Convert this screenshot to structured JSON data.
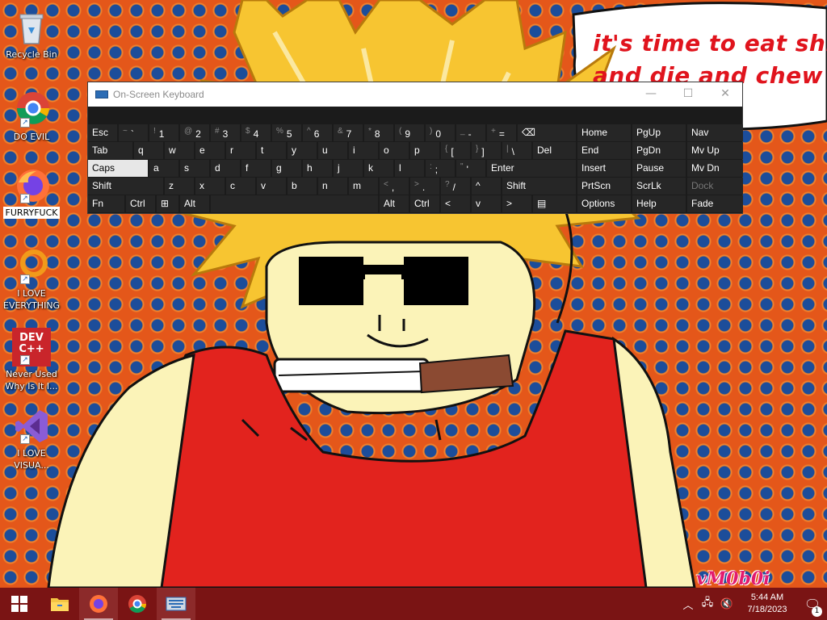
{
  "wallpaper": {
    "speech_line1": "it's time to eat shit",
    "speech_line2": "and die and chew",
    "watermark": "vM0b0i"
  },
  "desktop_icons": [
    {
      "label": "Recycle Bin",
      "icon": "recycle-bin-icon"
    },
    {
      "label": "DO EVIL",
      "icon": "chrome-icon"
    },
    {
      "label": "FURRYFUCK",
      "icon": "firefox-icon"
    },
    {
      "label": "I LOVE EVERYTHING",
      "icon": "ring-icon"
    },
    {
      "label": "Never Used Why Is It I...",
      "icon": "dev-cpp-icon",
      "badge": "DEV C++"
    },
    {
      "label": "I LOVE VISUA...",
      "icon": "visual-studio-icon"
    }
  ],
  "osk": {
    "title": "On-Screen Keyboard",
    "row1": [
      {
        "m": "Esc"
      },
      {
        "s": "~",
        "m": "`"
      },
      {
        "s": "!",
        "m": "1"
      },
      {
        "s": "@",
        "m": "2"
      },
      {
        "s": "#",
        "m": "3"
      },
      {
        "s": "$",
        "m": "4"
      },
      {
        "s": "%",
        "m": "5"
      },
      {
        "s": "^",
        "m": "6"
      },
      {
        "s": "&",
        "m": "7"
      },
      {
        "s": "*",
        "m": "8"
      },
      {
        "s": "(",
        "m": "9"
      },
      {
        "s": ")",
        "m": "0"
      },
      {
        "s": "_",
        "m": "-"
      },
      {
        "s": "+",
        "m": "="
      },
      {
        "m": "⌫"
      }
    ],
    "row2": [
      {
        "m": "Tab"
      },
      {
        "m": "q"
      },
      {
        "m": "w"
      },
      {
        "m": "e"
      },
      {
        "m": "r"
      },
      {
        "m": "t"
      },
      {
        "m": "y"
      },
      {
        "m": "u"
      },
      {
        "m": "i"
      },
      {
        "m": "o"
      },
      {
        "m": "p"
      },
      {
        "s": "{",
        "m": "["
      },
      {
        "s": "}",
        "m": "]"
      },
      {
        "s": "|",
        "m": "\\"
      },
      {
        "m": "Del"
      }
    ],
    "row3": [
      {
        "m": "Caps"
      },
      {
        "m": "a"
      },
      {
        "m": "s"
      },
      {
        "m": "d"
      },
      {
        "m": "f"
      },
      {
        "m": "g"
      },
      {
        "m": "h"
      },
      {
        "m": "j"
      },
      {
        "m": "k"
      },
      {
        "m": "l"
      },
      {
        "s": ":",
        "m": ";"
      },
      {
        "s": "\"",
        "m": "'"
      },
      {
        "m": "Enter"
      }
    ],
    "row4": [
      {
        "m": "Shift"
      },
      {
        "m": "z"
      },
      {
        "m": "x"
      },
      {
        "m": "c"
      },
      {
        "m": "v"
      },
      {
        "m": "b"
      },
      {
        "m": "n"
      },
      {
        "m": "m"
      },
      {
        "s": "<",
        "m": ","
      },
      {
        "s": ">",
        "m": "."
      },
      {
        "s": "?",
        "m": "/"
      },
      {
        "m": "^"
      },
      {
        "m": "Shift"
      }
    ],
    "row5": [
      {
        "m": "Fn"
      },
      {
        "m": "Ctrl"
      },
      {
        "m": "⊞"
      },
      {
        "m": "Alt"
      },
      {
        "m": ""
      },
      {
        "m": "Alt"
      },
      {
        "m": "Ctrl"
      },
      {
        "m": "<"
      },
      {
        "m": "v"
      },
      {
        "m": ">"
      },
      {
        "m": "▤"
      }
    ],
    "nav": [
      [
        "Home",
        "PgUp",
        "Nav"
      ],
      [
        "End",
        "PgDn",
        "Mv Up"
      ],
      [
        "Insert",
        "Pause",
        "Mv Dn"
      ],
      [
        "PrtScn",
        "ScrLk",
        "Dock"
      ],
      [
        "Options",
        "Help",
        "Fade"
      ]
    ]
  },
  "taskbar": {
    "clock_time": "5:44 AM",
    "clock_date": "7/18/2023",
    "notification_count": "1"
  }
}
